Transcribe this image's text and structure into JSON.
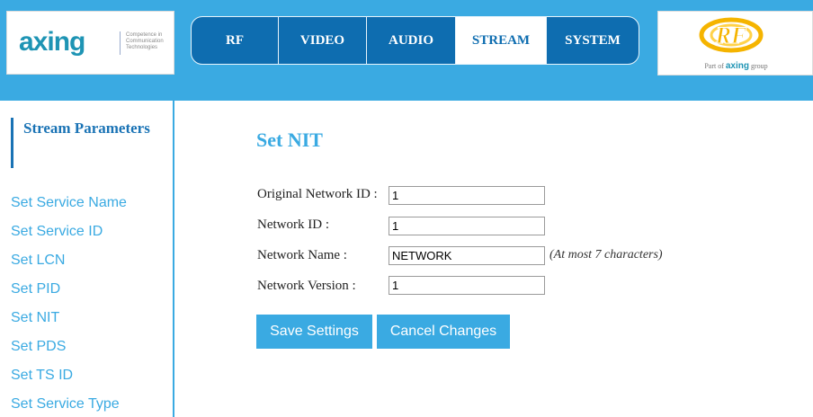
{
  "header": {
    "left_logo": {
      "wordmark": "axing",
      "tagline": "Competence in Communication Technologies"
    },
    "right_logo": {
      "mark": "RF",
      "part_of_prefix": "Part of",
      "part_of_brand": "axing",
      "part_of_suffix": "group"
    },
    "brand_color": "#3aaae2",
    "nav_color": "#0e6db0"
  },
  "nav": {
    "tabs": [
      {
        "label": "RF"
      },
      {
        "label": "VIDEO"
      },
      {
        "label": "AUDIO"
      },
      {
        "label": "STREAM",
        "active": true
      },
      {
        "label": "SYSTEM"
      }
    ]
  },
  "sidebar": {
    "title": "Stream Parameters",
    "items": [
      {
        "label": "Set Service Name"
      },
      {
        "label": "Set Service ID"
      },
      {
        "label": "Set LCN"
      },
      {
        "label": "Set PID"
      },
      {
        "label": "Set NIT"
      },
      {
        "label": "Set PDS"
      },
      {
        "label": "Set TS ID"
      },
      {
        "label": "Set Service Type"
      }
    ]
  },
  "main": {
    "title": "Set NIT",
    "fields": [
      {
        "label": "Original Network ID :",
        "value": "1"
      },
      {
        "label": "Network ID :",
        "value": "1"
      },
      {
        "label": "Network Name :",
        "value": "NETWORK",
        "hint": "(At most 7 characters)"
      },
      {
        "label": "Network Version :",
        "value": "1"
      }
    ],
    "buttons": {
      "save": "Save Settings",
      "cancel": "Cancel Changes"
    }
  }
}
